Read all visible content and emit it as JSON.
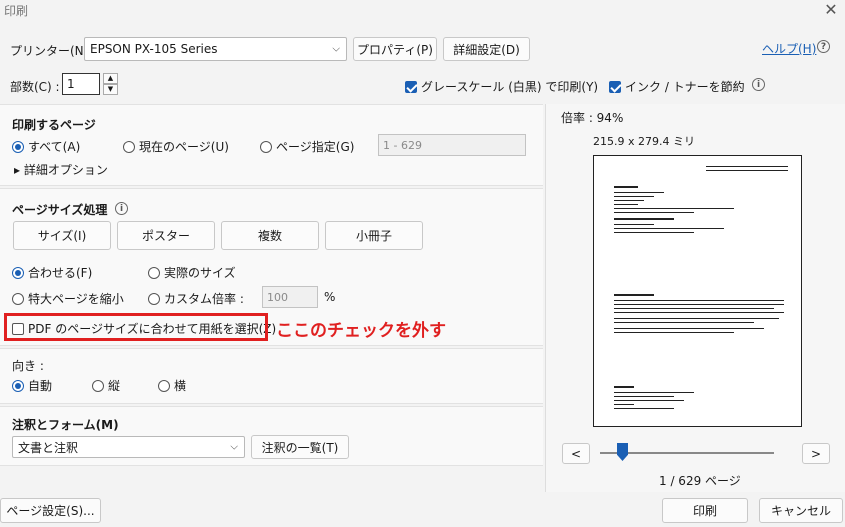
{
  "window": {
    "title": "印刷",
    "close": "✕"
  },
  "printer": {
    "label": "プリンター(N) :",
    "selected": "EPSON PX-105 Series",
    "properties": "プロパティ(P)",
    "advanced": "詳細設定(D)",
    "help": "ヘルプ(H)"
  },
  "copies": {
    "label": "部数(C) :",
    "value": "1"
  },
  "options": {
    "grayscale": "グレースケール (白黒) で印刷(Y)",
    "save_ink": "インク / トナーを節約"
  },
  "pages": {
    "title": "印刷するページ",
    "all": "すべて(A)",
    "current": "現在のページ(U)",
    "range_label": "ページ指定(G)",
    "range_value": "1 - 629",
    "more": "▸ 詳細オプション"
  },
  "sizing": {
    "title": "ページサイズ処理",
    "buttons": [
      "サイズ(I)",
      "ポスター",
      "複数",
      "小冊子"
    ],
    "fit": "合わせる(F)",
    "actual": "実際のサイズ",
    "shrink": "特大ページを縮小",
    "custom": "カスタム倍率 :",
    "custom_value": "100",
    "percent": "%",
    "choose_paper": "PDF のページサイズに合わせて用紙を選択(Z)",
    "annotation": "ここのチェックを外す"
  },
  "orientation": {
    "title": "向き :",
    "auto": "自動",
    "portrait": "縦",
    "landscape": "横"
  },
  "comments": {
    "title": "注釈とフォーム(M)",
    "selected": "文書と注釈",
    "summary": "注釈の一覧(T)"
  },
  "preview": {
    "zoom": "倍率 : 94%",
    "size": "215.9 x 279.4 ミリ",
    "page_info": "1 / 629 ページ",
    "prev": "<",
    "next": ">",
    "slider_position": 0
  },
  "footer": {
    "page_setup": "ページ設定(S)...",
    "print": "印刷",
    "cancel": "キャンセル"
  }
}
